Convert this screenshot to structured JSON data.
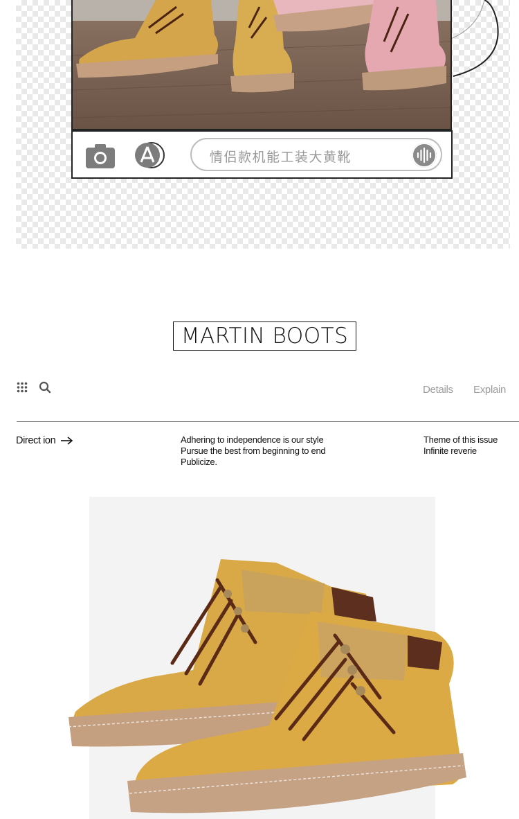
{
  "toolbar": {
    "search_text": "情侣款机能工装大黄靴",
    "icons": [
      "camera-icon",
      "app-store-icon",
      "voice-icon"
    ]
  },
  "heading": {
    "title": "MARTIN BOOTS"
  },
  "nav": {
    "icons": [
      "grid-icon",
      "search-icon"
    ],
    "details": "Details",
    "explain": "Explain"
  },
  "info": {
    "direction": "Direct ion",
    "middle": [
      "Adhering to independence is our style",
      "Pursue the best from beginning to end",
      "Publicize."
    ],
    "right": [
      "Theme of this issue",
      "Infinite reverie"
    ]
  },
  "colors": {
    "boot_yellow": "#d9a53c",
    "boot_canvas": "#c9a259",
    "sole": "#c7a283",
    "lace": "#5a2a16",
    "pink_boot": "#e7aab3",
    "floor": "#7b6455"
  }
}
